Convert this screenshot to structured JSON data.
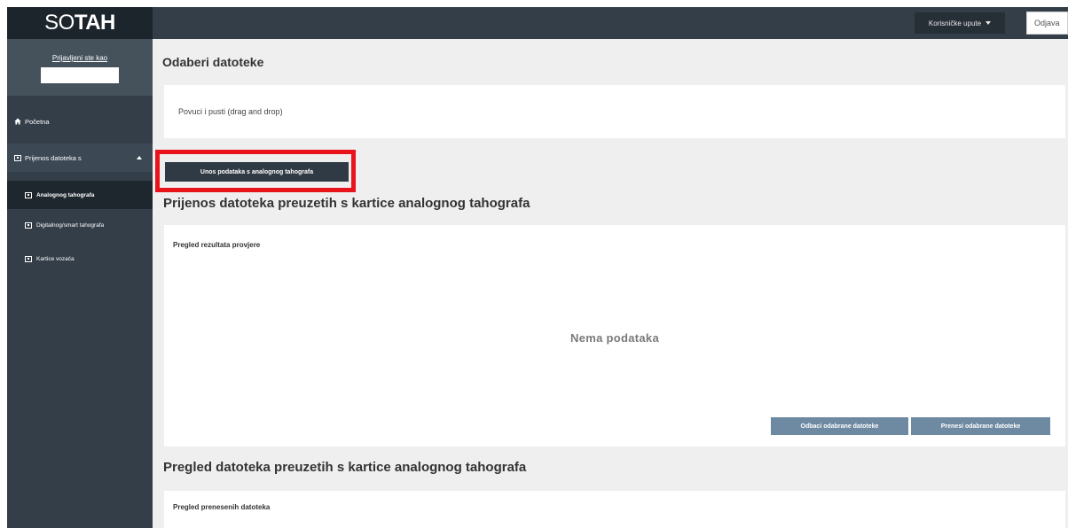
{
  "header": {
    "logo_prefix": "SO",
    "logo_suffix": "TAH",
    "user_guide_label": "Korisničke upute",
    "logout_label": "Odjava"
  },
  "sidebar": {
    "signed_in_label": "Prijavljeni ste kao",
    "home_label": "Početna",
    "transfer_label": "Prijenos datoteka s",
    "items": [
      {
        "label": "Analognog tahografa"
      },
      {
        "label": "Digitalnog/smart tahografa"
      },
      {
        "label": "Kartice vozača"
      }
    ]
  },
  "main": {
    "select_files_title": "Odaberi datoteke",
    "dropzone_text": "Povuci i pusti (drag and drop)",
    "upload_button_label": "Unos podataka s analognog tahografa",
    "transfer_title": "Prijenos datoteka preuzetih s kartice analognog tahografa",
    "results_label": "Pregled rezultata provjere",
    "empty_text": "Nema podataka",
    "discard_button_label": "Odbaci odabrane datoteke",
    "transfer_button_label": "Prenesi odabrane datoteke",
    "review_title": "Pregled datoteka preuzetih s kartice analognog tahografa",
    "transferred_label": "Pregled prenesenih datoteka"
  },
  "colors": {
    "topbar": "#333e48",
    "sidebar_active": "#1f272e",
    "highlight_frame": "#e8131b",
    "action_button": "#6e8aa2"
  }
}
